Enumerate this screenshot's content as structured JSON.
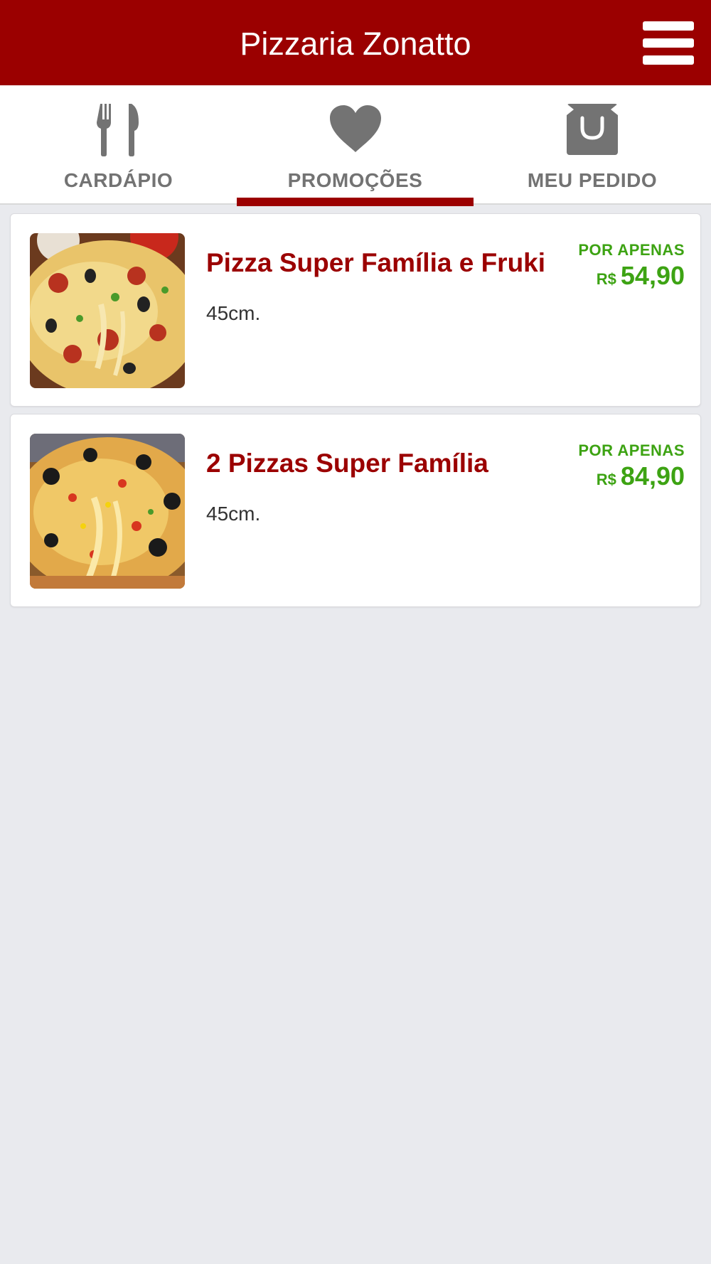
{
  "header": {
    "title": "Pizzaria Zonatto",
    "menu_icon": "hamburger-menu-icon"
  },
  "tabs": [
    {
      "label": "CARDÁPIO",
      "icon": "fork-knife-icon",
      "active": false
    },
    {
      "label": "PROMOÇÕES",
      "icon": "heart-icon",
      "active": true
    },
    {
      "label": "MEU PEDIDO",
      "icon": "shopping-bag-icon",
      "active": false
    }
  ],
  "promotions": [
    {
      "title": "Pizza Super Família e Fruki",
      "description": "45cm.",
      "price_label": "POR APENAS",
      "currency": "R$",
      "price": "54,90"
    },
    {
      "title": "2 Pizzas Super Família",
      "description": "45cm.",
      "price_label": "POR APENAS",
      "currency": "R$",
      "price": "84,90"
    }
  ],
  "colors": {
    "brand": "#9b0000",
    "price_green": "#3da313",
    "tab_gray": "#737373",
    "background": "#e9eaee"
  }
}
